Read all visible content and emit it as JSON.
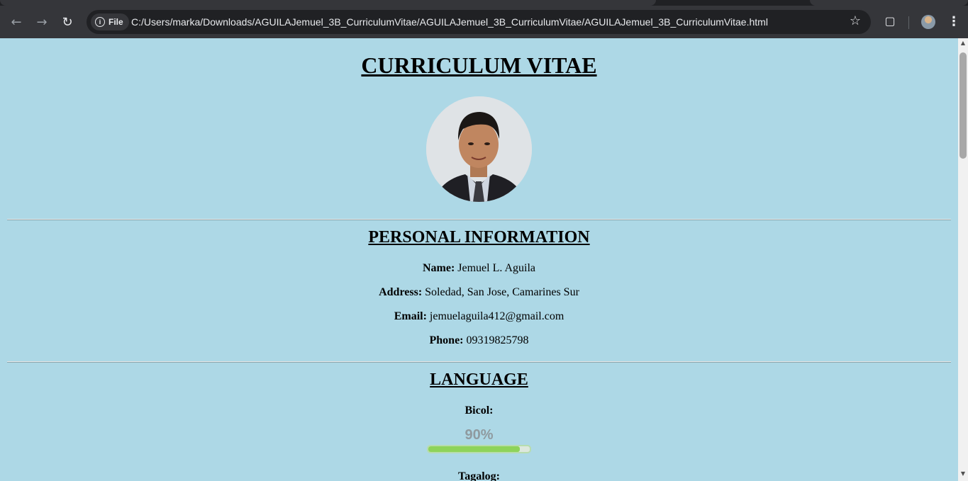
{
  "browser": {
    "file_chip": "File",
    "url": "C:/Users/marka/Downloads/AGUILAJemuel_3B_CurriculumVitae/AGUILAJemuel_3B_CurriculumVitae/AGUILAJemuel_3B_CurriculumVitae.html"
  },
  "page": {
    "title": "CURRICULUM VITAE",
    "personal": {
      "heading": "PERSONAL INFORMATION",
      "name_label": "Name:",
      "name_value": " Jemuel L. Aguila",
      "address_label": "Address:",
      "address_value": " Soledad, San Jose, Camarines Sur",
      "email_label": "Email:",
      "email_value": " jemuelaguila412@gmail.com",
      "phone_label": "Phone:",
      "phone_value": " 09319825798"
    },
    "language": {
      "heading": "LANGUAGE",
      "items": [
        {
          "name": "Bicol:",
          "percent_label": "90%",
          "level": 0.9
        },
        {
          "name": "Tagalog:"
        }
      ]
    }
  },
  "colors": {
    "page_background": "#add8e6",
    "progress_fill": "#8ed35a",
    "progress_track": "#dde8dd"
  }
}
